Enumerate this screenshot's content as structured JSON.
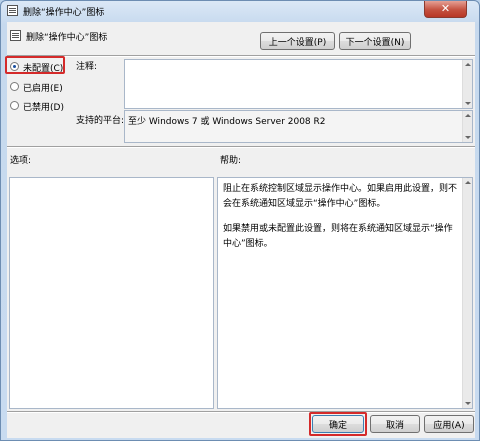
{
  "window": {
    "title": "删除“操作中心”图标",
    "close_label": "✕"
  },
  "header": {
    "title": "删除“操作中心”图标",
    "prev_button": "上一个设置(P)",
    "next_button": "下一个设置(N)"
  },
  "state": {
    "options": [
      {
        "label": "未配置(C)",
        "selected": true
      },
      {
        "label": "已启用(E)",
        "selected": false
      },
      {
        "label": "已禁用(D)",
        "selected": false
      }
    ]
  },
  "comment": {
    "label": "注释:",
    "value": ""
  },
  "supported": {
    "label": "支持的平台:",
    "value": "至少 Windows 7 或 Windows Server 2008 R2"
  },
  "options_panel": {
    "label": "选项:"
  },
  "help_panel": {
    "label": "帮助:",
    "paragraph1": "阻止在系统控制区域显示操作中心。如果启用此设置，则不会在系统通知区域显示“操作中心”图标。",
    "paragraph2": "如果禁用或未配置此设置，则将在系统通知区域显示“操作中心”图标。"
  },
  "footer": {
    "ok_button": "确定",
    "cancel_button": "取消",
    "apply_button": "应用(A)"
  },
  "colors": {
    "highlight_border": "#d42a2a",
    "close_button": "#c45140"
  }
}
